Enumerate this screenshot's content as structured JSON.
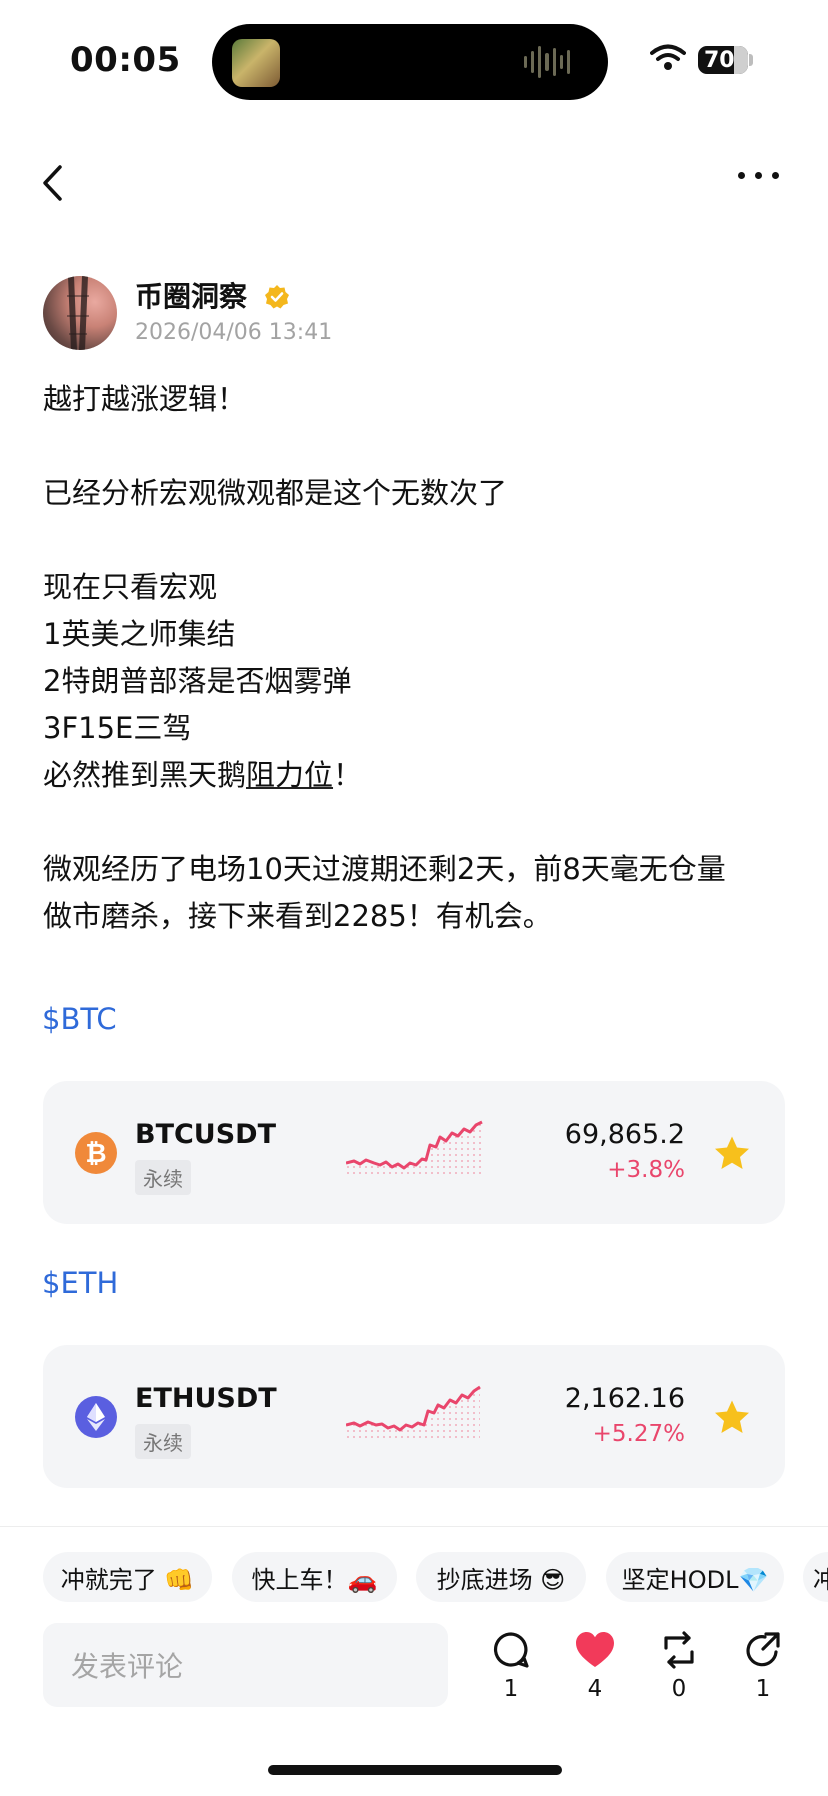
{
  "status_bar": {
    "time": "00:05",
    "battery": "70"
  },
  "author": {
    "name": "币圈洞察",
    "time": "2026/04/06 13:41"
  },
  "post": {
    "lines": [
      "越打越涨逻辑！",
      "",
      "已经分析宏观微观都是这个无数次了",
      "",
      "现在只看宏观",
      "1英美之师集结",
      "2特朗普部落是否烟雾弹",
      "3F15E三驾"
    ],
    "line_before_ul": "必然推到黑天鹅",
    "underlined": "阻力位",
    "line_after_ul": "！",
    "para2_line1": "微观经历了电场10天过渡期还剩2天，前8天毫无仓量",
    "para2_line2": "做市磨杀，接下来看到2285！有机会。"
  },
  "tags": {
    "btc": "$BTC",
    "eth": "$ETH"
  },
  "tickers": [
    {
      "pair": "BTCUSDT",
      "type": "永续",
      "price": "69,865.2",
      "change": "+3.8%",
      "icon_symbol": "₿",
      "icon_color": "#f0893a"
    },
    {
      "pair": "ETHUSDT",
      "type": "永续",
      "price": "2,162.16",
      "change": "+5.27%",
      "icon_symbol": "◆",
      "icon_color": "#5a5fe0"
    }
  ],
  "quick_replies": [
    "冲就完了 👊",
    "快上车！🚗",
    "抄底进场 😎",
    "坚定HODL💎",
    "冲"
  ],
  "comment": {
    "placeholder": "发表评论"
  },
  "actions": {
    "comments": "1",
    "likes": "4",
    "reposts": "0",
    "shares": "1"
  },
  "colors": {
    "link": "#2f6ad9",
    "up": "#e9466c",
    "star": "#f7c01c",
    "like": "#f23a5a"
  }
}
